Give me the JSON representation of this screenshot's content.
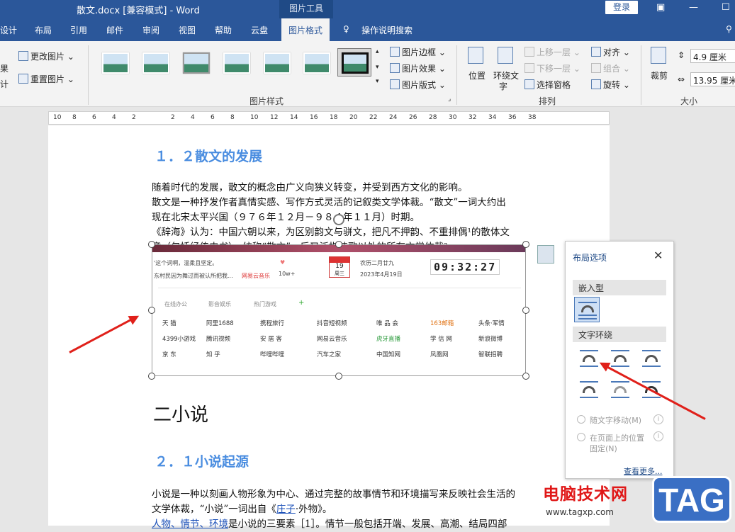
{
  "titlebar": {
    "doc_title": "散文.docx [兼容模式]  -  Word",
    "context_tab": "图片工具",
    "login": "登录"
  },
  "tabs": [
    "设计",
    "布局",
    "引用",
    "邮件",
    "审阅",
    "视图",
    "帮助",
    "云盘",
    "图片格式",
    "操作说明搜索"
  ],
  "ribbon": {
    "left_items": [
      "更改图片",
      "重置图片"
    ],
    "left_stub": [
      "果",
      "计"
    ],
    "styles_group_label": "图片样式",
    "style_cmds": [
      "图片边框",
      "图片效果",
      "图片版式"
    ],
    "arrange": {
      "position": "位置",
      "wrap": "环绕文",
      "wrap2": "字",
      "forward": "上移一层",
      "backward": "下移一层",
      "pane": "选择窗格",
      "align": "对齐",
      "group": "组合",
      "rotate": "旋转",
      "label": "排列"
    },
    "size": {
      "crop": "裁剪",
      "height": "4.9 厘米",
      "width": "13.95 厘米",
      "label": "大小"
    }
  },
  "ruler": [
    "10",
    "8",
    "6",
    "4",
    "2",
    "2",
    "4",
    "6",
    "8",
    "10",
    "12",
    "14",
    "16",
    "18",
    "20",
    "22",
    "24",
    "26",
    "28",
    "30",
    "32",
    "34",
    "36",
    "38"
  ],
  "doc": {
    "h2a": "１．２散文的发展",
    "p1": [
      "随着时代的发展，散文的概念由广义向狭义转变，并受到西方文化的影响。",
      "散文是一种抒发作者真情实感、写作方式灵活的记叙类文学体裁。“散文”一词大约出",
      "现在北宋太平兴国（９７６年１２月－９８４年１１月）时期。",
      "《辞海》认为：中国六朝以来，为区别韵文与骈文，把凡不押韵、不重排偶¹的散体文",
      "章（包括经传史书），统称“散文”。后又泛指诗歌以外的所有文学体裁²"
    ],
    "h1": "二小说",
    "h2b": "２．１小说起源",
    "p2": [
      "小说是一种以刻画人物形象为中心、通过完整的故事情节和环境描写来反映社会生活的",
      "文学体裁，“小说”一词出自《",
      "庄子",
      "·外物》。",
      "人物、情节、环境",
      "是小说的三要素［1］。情节一般包括开端、发展、高潮、结局四部"
    ]
  },
  "image": {
    "clock": "09:32:27",
    "cal_day": "19",
    "cal_week": "周三",
    "lunar": "农历二月廿九",
    "date": "2023年4月19日",
    "topline": "'这个词啊，温柔且坚定。",
    "subline": "东村民因为舞过而被认所把我...",
    "music": "网易云音乐",
    "count": "10w+",
    "tabs": [
      "在线办公",
      "影音娱乐",
      "热门游戏",
      "+"
    ],
    "sites": [
      [
        "天 猫",
        "阿里1688",
        "携程旅行",
        "抖音短视频",
        "唯 品 会",
        "163邮箱",
        "头条·军情"
      ],
      [
        "4399小游戏",
        "腾讯视频",
        "安 居 客",
        "网易云音乐",
        "虎牙直播",
        "学 信 网",
        "新浪微博"
      ],
      [
        "京 东",
        "知 乎",
        "哔哩哔哩",
        "汽车之家",
        "中国知网",
        "凤凰网",
        "智联招聘"
      ]
    ]
  },
  "pane": {
    "title": "布局选项",
    "inline": "嵌入型",
    "wrap": "文字环绕",
    "opt1": "随文字移动(M)",
    "opt2a": "在页面上的位置",
    "opt2b": "固定(N)",
    "more": "查看更多..."
  },
  "watermark": {
    "text": "电脑技术网",
    "url": "www.tagxp.com",
    "logo": "TAG"
  }
}
